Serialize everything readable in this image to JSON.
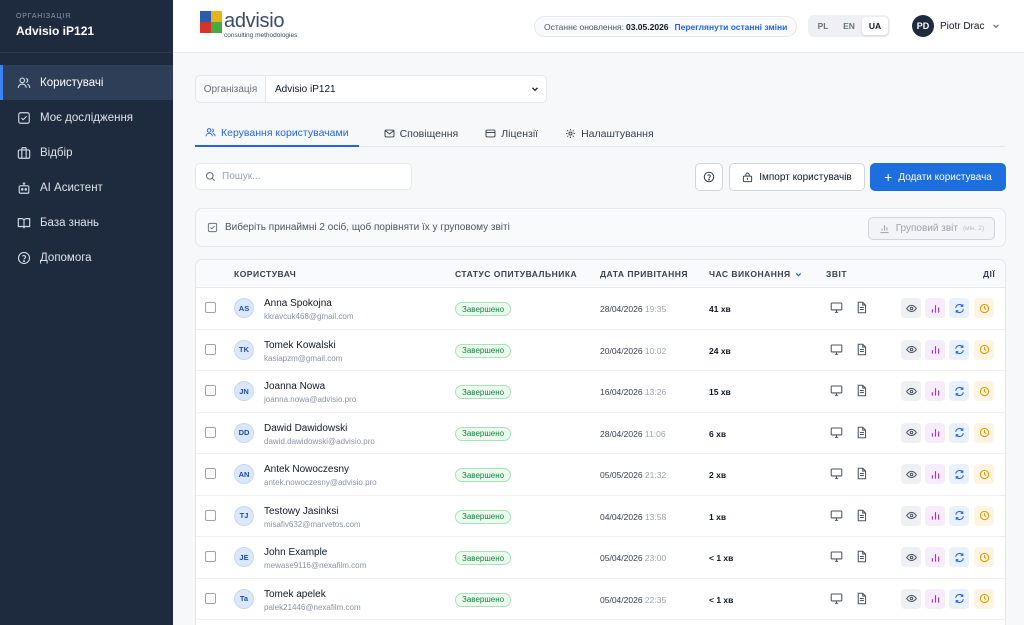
{
  "sidebar": {
    "org_label": "ОРГАНІЗАЦІЯ",
    "org_name": "Advisio iP121",
    "items": [
      {
        "label": "Користувачі",
        "icon": "users-icon",
        "active": true
      },
      {
        "label": "Моє дослідження",
        "icon": "checkbox-icon",
        "active": false
      },
      {
        "label": "Відбір",
        "icon": "briefcase-icon",
        "active": false
      },
      {
        "label": "AI Асистент",
        "icon": "robot-icon",
        "active": false
      },
      {
        "label": "База знань",
        "icon": "book-icon",
        "active": false
      },
      {
        "label": "Допомога",
        "icon": "help-icon",
        "active": false
      }
    ]
  },
  "header": {
    "logo_word": "advisio",
    "logo_sub": "consulting methodologies",
    "last_update_label": "Останнє оновлення:",
    "last_update_date": "03.05.2026",
    "last_update_link": "Переглянути останні зміни",
    "languages": [
      "PL",
      "EN",
      "UA"
    ],
    "active_language": "UA",
    "user_initials": "PD",
    "user_name": "Piotr Drac"
  },
  "main": {
    "org_select_label": "Організація",
    "org_select_value": "Advisio iP121",
    "tabs": [
      {
        "label": "Керування користувачами",
        "icon": "users-icon"
      },
      {
        "label": "Сповіщення",
        "icon": "mail-icon"
      },
      {
        "label": "Ліцензії",
        "icon": "card-icon"
      },
      {
        "label": "Налаштування",
        "icon": "gear-icon"
      }
    ],
    "search_placeholder": "Пошук...",
    "import_label": "Імпорт користувачів",
    "add_label": "Додати користувача",
    "hint": "Виберіть принаймні 2 осіб, щоб порівняти їх у груповому звіті",
    "group_report_label": "Груповий звіт",
    "group_report_min": "(мін. 2)"
  },
  "table": {
    "headers": {
      "user": "КОРИСТУВАЧ",
      "status": "СТАТУС ОПИТУВАЛЬНИКА",
      "date": "ДАТА ПРИВІТАННЯ",
      "time": "ЧАС ВИКОНАННЯ",
      "report": "ЗВІТ",
      "actions": "ДІЇ"
    },
    "rows": [
      {
        "initials": "AS",
        "name": "Anna Spokojna",
        "email": "kkravcuk468@gmail.com",
        "status": "Завершено",
        "date": "28/04/2026",
        "hour": "19:35",
        "time": "41 хв"
      },
      {
        "initials": "TK",
        "name": "Tomek Kowalski",
        "email": "kasiapzm@gmail.com",
        "status": "Завершено",
        "date": "20/04/2026",
        "hour": "10:02",
        "time": "24 хв"
      },
      {
        "initials": "JN",
        "name": "Joanna Nowa",
        "email": "joanna.nowa@advisio.pro",
        "status": "Завершено",
        "date": "16/04/2026",
        "hour": "13:26",
        "time": "15 хв"
      },
      {
        "initials": "DD",
        "name": "Dawid Dawidowski",
        "email": "dawid.dawidowski@advisio.pro",
        "status": "Завершено",
        "date": "28/04/2026",
        "hour": "11:06",
        "time": "6 хв"
      },
      {
        "initials": "AN",
        "name": "Antek Nowoczesny",
        "email": "antek.nowoczesny@advisio.pro",
        "status": "Завершено",
        "date": "05/05/2026",
        "hour": "21:32",
        "time": "2 хв"
      },
      {
        "initials": "TJ",
        "name": "Testowy Jasinksi",
        "email": "misafiv632@marvetos.com",
        "status": "Завершено",
        "date": "04/04/2026",
        "hour": "13:58",
        "time": "1 хв"
      },
      {
        "initials": "JE",
        "name": "John Example",
        "email": "mewase9116@nexafilm.com",
        "status": "Завершено",
        "date": "05/04/2026",
        "hour": "23:00",
        "time": "< 1 хв"
      },
      {
        "initials": "Ta",
        "name": "Tomek apelek",
        "email": "palek21446@nexafilm.com",
        "status": "Завершено",
        "date": "05/04/2026",
        "hour": "22:35",
        "time": "< 1 хв"
      }
    ]
  },
  "colors": {
    "sidebar_bg": "#1e2a3e",
    "accent": "#1d6fe0",
    "success": "#15803d"
  }
}
